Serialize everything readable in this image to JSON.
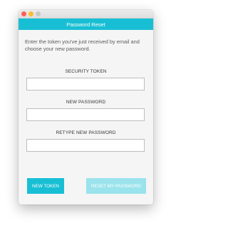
{
  "window": {
    "title": "Password Reset"
  },
  "intro": "Enter the token you've just received by email and choose your new password.",
  "fields": {
    "token": {
      "label": "SECURITY TOKEN",
      "value": "",
      "placeholder": ""
    },
    "new_password": {
      "label": "NEW PASSWORD",
      "value": "",
      "placeholder": ""
    },
    "retype_password": {
      "label": "RETYPE NEW PASSWORD",
      "value": "",
      "placeholder": ""
    }
  },
  "buttons": {
    "new_token": "NEW TOKEN",
    "reset": "RESET MY PASSWORD"
  },
  "colors": {
    "accent": "#18bfd4",
    "accent_disabled": "#9ae3ec",
    "close": "#fc5f57",
    "minimize": "#fdbc2e",
    "zoom": "#c8c8c8"
  }
}
